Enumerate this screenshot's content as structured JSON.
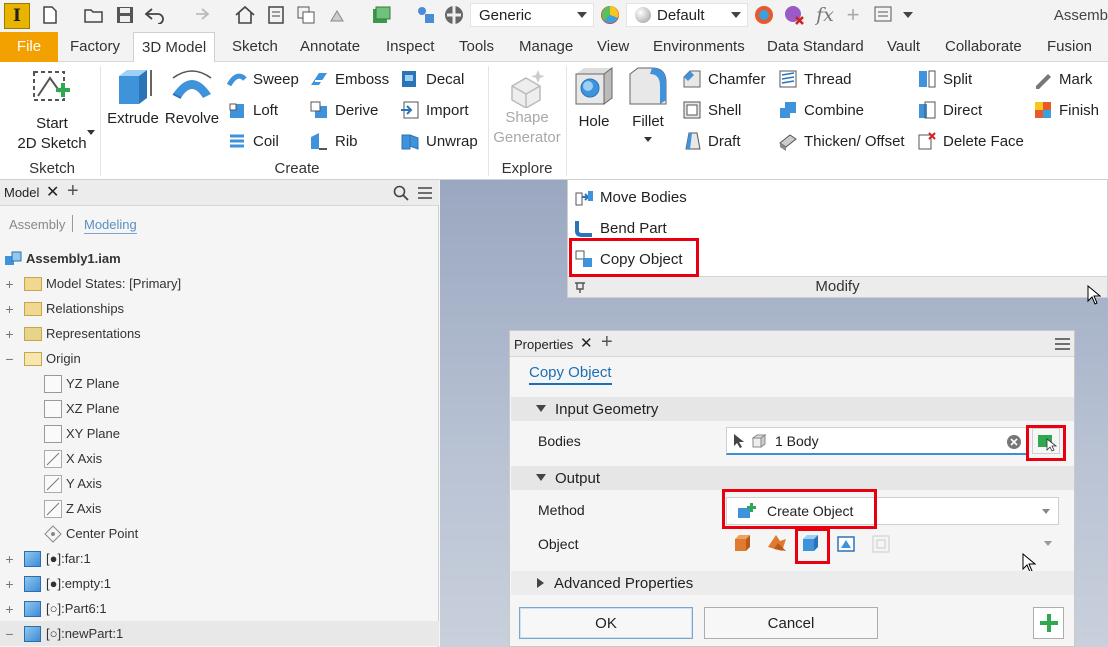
{
  "app": {
    "logo": "I",
    "title": "Assemb"
  },
  "qat": {
    "material": "Generic",
    "appearance": "Default"
  },
  "tabs": [
    "File",
    "Factory",
    "3D Model",
    "Sketch",
    "Annotate",
    "Inspect",
    "Tools",
    "Manage",
    "View",
    "Environments",
    "Data Standard",
    "Vault",
    "Collaborate",
    "Fusion"
  ],
  "ribbon": {
    "sketch": {
      "start_label_1": "Start",
      "start_label_2": "2D Sketch",
      "panel": "Sketch"
    },
    "create": {
      "extrude": "Extrude",
      "revolve": "Revolve",
      "sweep": "Sweep",
      "loft": "Loft",
      "coil": "Coil",
      "emboss": "Emboss",
      "derive": "Derive",
      "rib": "Rib",
      "decal": "Decal",
      "import": "Import",
      "unwrap": "Unwrap",
      "panel": "Create"
    },
    "explore": {
      "shape_1": "Shape",
      "shape_2": "Generator",
      "panel": "Explore"
    },
    "modify": {
      "hole": "Hole",
      "fillet": "Fillet",
      "chamfer": "Chamfer",
      "shell": "Shell",
      "draft": "Draft",
      "thread": "Thread",
      "combine": "Combine",
      "thicken": "Thicken/ Offset",
      "split": "Split",
      "direct": "Direct",
      "delete_face": "Delete Face",
      "mark": "Mark",
      "finish": "Finish",
      "panel": "Modify"
    },
    "modify_dropdown": {
      "move_bodies": "Move Bodies",
      "bend_part": "Bend Part",
      "copy_object": "Copy Object"
    }
  },
  "browser": {
    "tab": "Model",
    "modes": [
      "Assembly",
      "Modeling"
    ],
    "tree": [
      {
        "label": "Assembly1.iam"
      },
      {
        "label": "Model States: [Primary]"
      },
      {
        "label": "Relationships"
      },
      {
        "label": "Representations"
      },
      {
        "label": "Origin"
      },
      {
        "label": "YZ Plane"
      },
      {
        "label": "XZ Plane"
      },
      {
        "label": "XY Plane"
      },
      {
        "label": "X Axis"
      },
      {
        "label": "Y Axis"
      },
      {
        "label": "Z Axis"
      },
      {
        "label": "Center Point"
      },
      {
        "label": "[●]:far:1"
      },
      {
        "label": "[●]:empty:1"
      },
      {
        "label": "[○]:Part6:1"
      },
      {
        "label": "[○]:newPart:1"
      }
    ]
  },
  "properties": {
    "tab": "Properties",
    "command": "Copy Object",
    "input_section": "Input Geometry",
    "bodies_label": "Bodies",
    "bodies_value": "1 Body",
    "output_section": "Output",
    "method_label": "Method",
    "method_value": "Create Object",
    "object_label": "Object",
    "advanced": "Advanced Properties",
    "ok": "OK",
    "cancel": "Cancel"
  },
  "colors": {
    "file_tab": "#f2a100",
    "highlight": "#e8000f",
    "link": "#1a6fb5",
    "accent_green": "#2fa84f"
  }
}
